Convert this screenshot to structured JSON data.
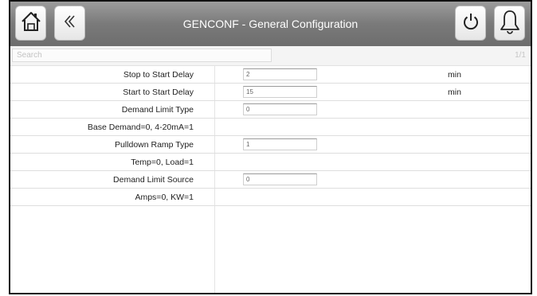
{
  "window": {
    "title": "GENCONF - General Configuration"
  },
  "header": {
    "buttons": [
      {
        "name": "home-button",
        "icon": "home-icon"
      },
      {
        "name": "back-button",
        "icon": "double-chevron-left-icon"
      },
      {
        "name": "power-button",
        "icon": "power-icon"
      },
      {
        "name": "alarm-button",
        "icon": "bell-icon"
      }
    ]
  },
  "search": {
    "placeholder": "Search",
    "value": "",
    "count": "1/1"
  },
  "rows": [
    {
      "label": "Stop to Start Delay",
      "value": "2",
      "unit": "min"
    },
    {
      "label": "Start to Start Delay",
      "value": "15",
      "unit": "min"
    },
    {
      "label": "Demand Limit Type",
      "value": "0",
      "unit": ""
    },
    {
      "label": "Base Demand=0, 4-20mA=1",
      "value": null,
      "unit": ""
    },
    {
      "label": "Pulldown Ramp Type",
      "value": "1",
      "unit": ""
    },
    {
      "label": "Temp=0, Load=1",
      "value": null,
      "unit": ""
    },
    {
      "label": "Demand Limit Source",
      "value": "0",
      "unit": ""
    },
    {
      "label": "Amps=0, KW=1",
      "value": null,
      "unit": ""
    }
  ],
  "colors": {
    "header": "#7a7a7a",
    "title_text": "#ffffff",
    "row_border": "#dedede"
  }
}
